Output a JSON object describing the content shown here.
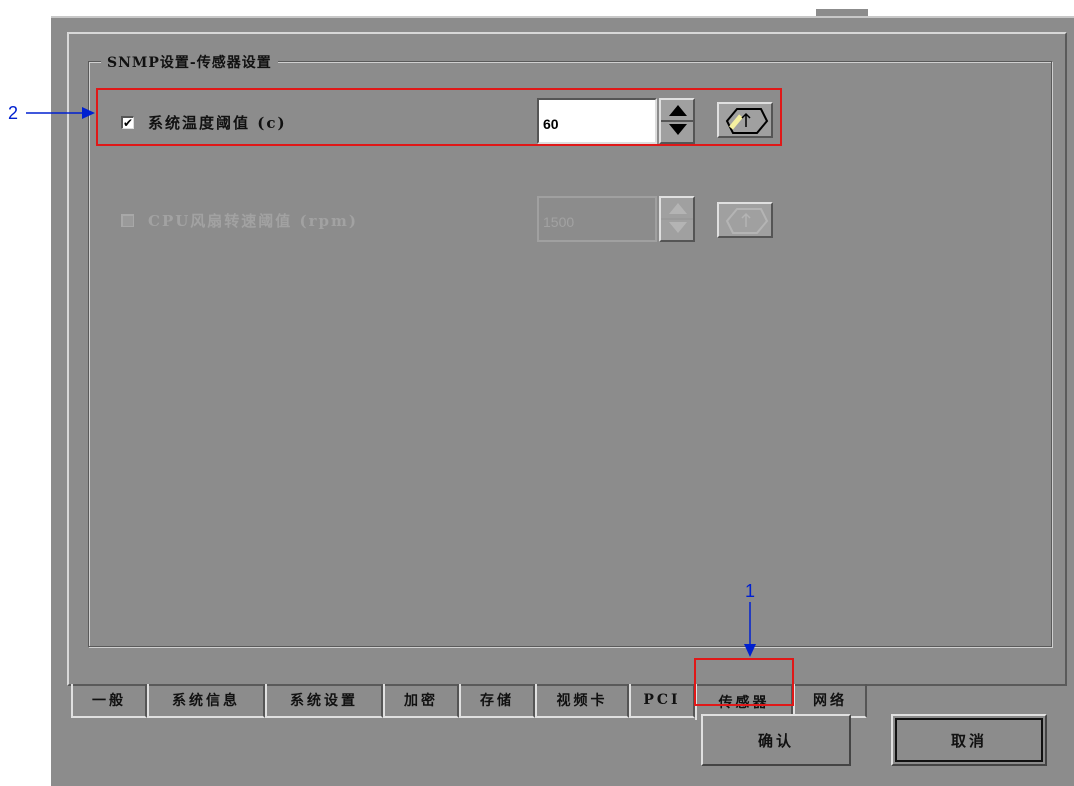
{
  "group_title": "SNMP设置-传感器设置",
  "rows": [
    {
      "label": "系统温度阈值 (c)",
      "checked": "✔",
      "value": "60",
      "enabled": true
    },
    {
      "label": "CPU风扇转速阈值 (rpm)",
      "checked": "",
      "value": "1500",
      "enabled": false
    }
  ],
  "tabs": [
    "一般",
    "系统信息",
    "系统设置",
    "加密",
    "存储",
    "视频卡",
    "PCI",
    "传感器",
    "网络"
  ],
  "active_tab": "传感器",
  "buttons": {
    "confirm": "确认",
    "cancel": "取消"
  },
  "annotations": {
    "label_1": "1",
    "label_2": "2"
  },
  "colors": {
    "highlight": "#e01818",
    "annotation": "#0020d0",
    "dialog_bg": "#8c8c8c"
  },
  "icons": [
    "keypad-icon",
    "spin-up-icon",
    "spin-down-icon",
    "checkmark-icon"
  ]
}
